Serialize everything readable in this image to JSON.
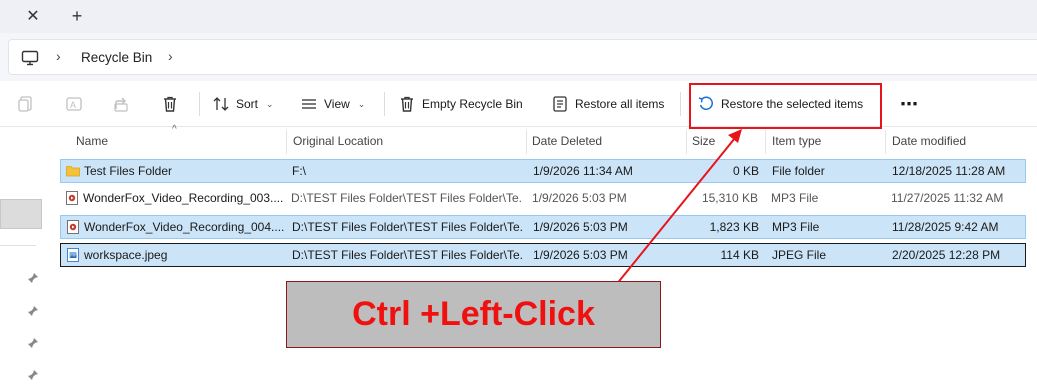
{
  "window": {
    "tab_close_glyph": "✕",
    "tab_new_glyph": "+"
  },
  "address": {
    "location_icon": "pc-monitor-icon",
    "separator": "›",
    "crumb": "Recycle Bin"
  },
  "toolbar": {
    "disabled_icons": [
      "copy-icon",
      "rename-icon",
      "share-icon"
    ],
    "delete_icon": "trash-icon",
    "sort_label": "Sort",
    "view_label": "View",
    "empty_label": "Empty Recycle Bin",
    "restore_all_label": "Restore all items",
    "restore_selected_label": "Restore the selected items",
    "more_label": "⋯"
  },
  "columns": [
    "Name",
    "Original Location",
    "Date Deleted",
    "Size",
    "Item type",
    "Date modified"
  ],
  "rows": [
    {
      "name": "Test Files Folder",
      "location": "F:\\",
      "deleted": "1/9/2026 11:34 AM",
      "size": "0 KB",
      "type": "File folder",
      "modified": "12/18/2025 11:28 AM",
      "icon": "folder-icon",
      "selected": true
    },
    {
      "name": "WonderFox_Video_Recording_003....",
      "location": "D:\\TEST Files Folder\\TEST Files Folder\\Te...",
      "deleted": "1/9/2026 5:03 PM",
      "size": "15,310 KB",
      "type": "MP3 File",
      "modified": "11/27/2025 11:32 AM",
      "icon": "media-file-icon",
      "selected": false
    },
    {
      "name": "WonderFox_Video_Recording_004....",
      "location": "D:\\TEST Files Folder\\TEST Files Folder\\Te...",
      "deleted": "1/9/2026 5:03 PM",
      "size": "1,823 KB",
      "type": "MP3 File",
      "modified": "11/28/2025 9:42 AM",
      "icon": "media-file-icon",
      "selected": true
    },
    {
      "name": "workspace.jpeg",
      "location": "D:\\TEST Files Folder\\TEST Files Folder\\Te...",
      "deleted": "1/9/2026 5:03 PM",
      "size": "114 KB",
      "type": "JPEG File",
      "modified": "2/20/2025 12:28 PM",
      "icon": "image-file-icon",
      "selected": true
    }
  ],
  "annotation": {
    "text": "Ctrl +Left-Click",
    "color": "#f01010",
    "box_color": "#bdbdbd"
  },
  "colors": {
    "selection": "#cce4f7",
    "selection_border": "#99c9ef",
    "highlight_border": "#e8141c"
  }
}
